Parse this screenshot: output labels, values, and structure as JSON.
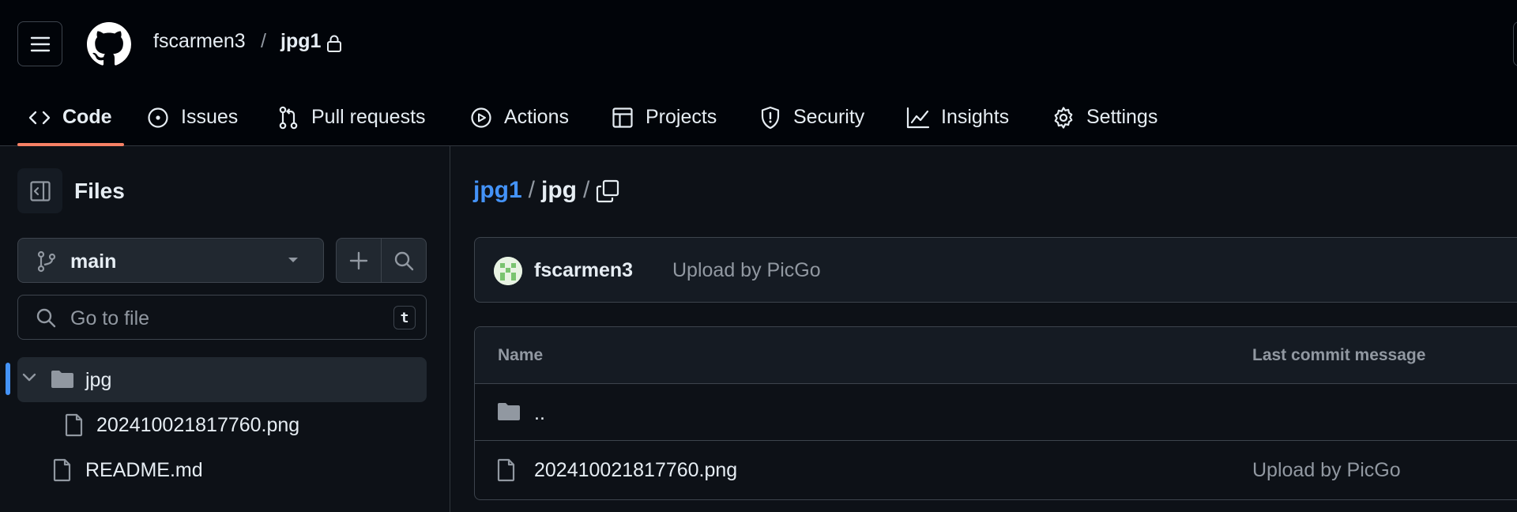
{
  "header": {
    "owner": "fscarmen3",
    "separator": "/",
    "repo": "jpg1",
    "menu_icon": "hamburger-icon",
    "logo_icon": "github-logo-icon",
    "lock_icon": "lock-icon"
  },
  "tabs": [
    {
      "label": "Code",
      "icon": "code-icon",
      "active": true
    },
    {
      "label": "Issues",
      "icon": "issue-opened-icon"
    },
    {
      "label": "Pull requests",
      "icon": "git-pull-request-icon"
    },
    {
      "label": "Actions",
      "icon": "play-icon"
    },
    {
      "label": "Projects",
      "icon": "table-icon"
    },
    {
      "label": "Security",
      "icon": "shield-icon"
    },
    {
      "label": "Insights",
      "icon": "graph-icon"
    },
    {
      "label": "Settings",
      "icon": "gear-icon"
    }
  ],
  "sidebar": {
    "title": "Files",
    "branch": "main",
    "goto_placeholder": "Go to file",
    "goto_shortcut": "t",
    "tree": [
      {
        "label": "jpg",
        "type": "folder",
        "expanded": true,
        "selected": true
      },
      {
        "label": "202410021817760.png",
        "type": "file"
      },
      {
        "label": "README.md",
        "type": "file"
      }
    ]
  },
  "main": {
    "path_root": "jpg1",
    "path_sep": "/",
    "path_dir": "jpg",
    "commit": {
      "author": "fscarmen3",
      "message": "Upload by PicGo"
    },
    "table": {
      "col_name": "Name",
      "col_message": "Last commit message",
      "rows": [
        {
          "name": "..",
          "type": "parent-folder",
          "message": ""
        },
        {
          "name": "202410021817760.png",
          "type": "file",
          "message": "Upload by PicGo"
        }
      ]
    }
  },
  "colors": {
    "accent_link": "#4493f8",
    "tab_underline": "#f78166",
    "background": "#0d1117",
    "header_background": "#010409"
  }
}
